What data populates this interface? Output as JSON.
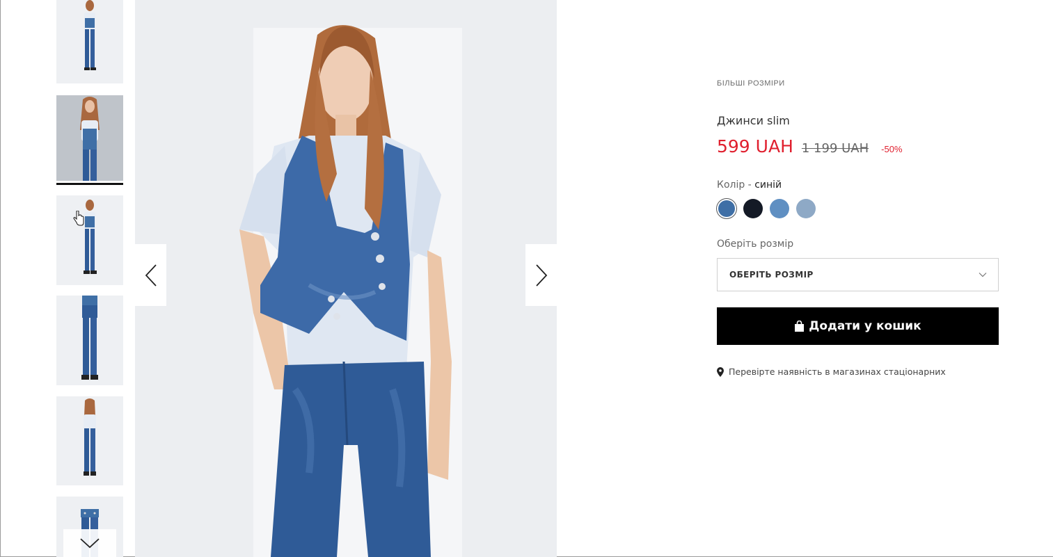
{
  "gallery": {
    "prev_icon": "chevron-left-icon",
    "next_icon": "chevron-right-icon",
    "scroll_down_icon": "chevron-down-icon"
  },
  "product": {
    "category": "БІЛЬШІ РОЗМІРИ",
    "title": "Джинси slim",
    "price_current": "599 UAH",
    "price_old": "1 199 UAH",
    "discount": "-50%",
    "color_label": "Колір - ",
    "color_value": "синій",
    "swatches": [
      {
        "name": "синій",
        "color": "#3f6fa6",
        "selected": true
      },
      {
        "name": "dark",
        "color": "#141a26",
        "selected": false
      },
      {
        "name": "light-blue",
        "color": "#5f8fc2",
        "selected": false
      },
      {
        "name": "pale-blue",
        "color": "#8ea9c6",
        "selected": false
      }
    ],
    "size_label": "Оберіть розмір",
    "size_select_placeholder": "ОБЕРІТЬ РОЗМІР",
    "add_to_cart": "Додати у кошик",
    "availability": "Перевірте наявність в магазинах стаціонарних"
  },
  "colors": {
    "accent_red": "#e0202f",
    "button_black": "#000000",
    "denim": "#3a64a0"
  }
}
